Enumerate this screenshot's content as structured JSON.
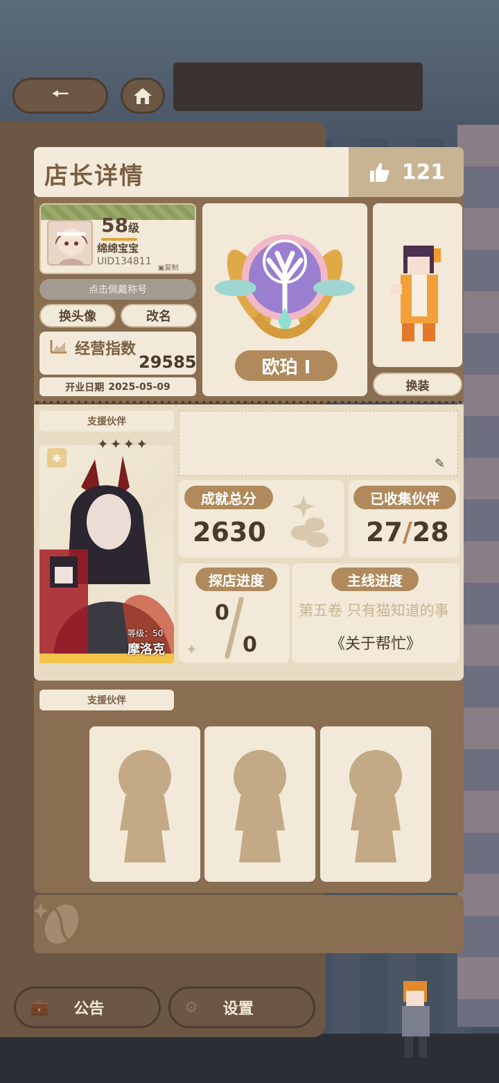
{
  "header": {
    "title": "店长详情",
    "like_count": "121"
  },
  "profile": {
    "level": "58",
    "level_suffix": "级",
    "nickname": "绵绵宝宝",
    "uid": "UID134811",
    "copy_label": "复制",
    "title_hint": "点击佩戴称号",
    "change_avatar": "换头像",
    "rename": "改名",
    "score_label": "经营指数",
    "score_value": "29585",
    "open_date_label": "开业日期",
    "open_date": "2025-05-09"
  },
  "badge": {
    "name": "欧珀 I"
  },
  "outfit": {
    "change_label": "换装"
  },
  "support": {
    "tag": "支援伙伴",
    "partner_level_label": "等级：50",
    "partner_name": "摩洛克"
  },
  "stats": {
    "achievement_label": "成就总分",
    "achievement_value": "2630",
    "collected_label": "已收集伙伴",
    "collected_current": "27",
    "collected_total": "28",
    "visit_label": "探店进度",
    "visit_current": "0",
    "visit_total": "0",
    "story_label": "主线进度",
    "story_chapter": "第五卷 只有猫知道的事",
    "story_episode": "《关于帮忙》"
  },
  "support2": {
    "tag": "支援伙伴"
  },
  "bottom_nav": {
    "notice": "公告",
    "settings": "设置"
  },
  "colors": {
    "panel_brown": "#8a6e52",
    "cream": "#f2e9d8",
    "accent_brown": "#b08a5c"
  }
}
